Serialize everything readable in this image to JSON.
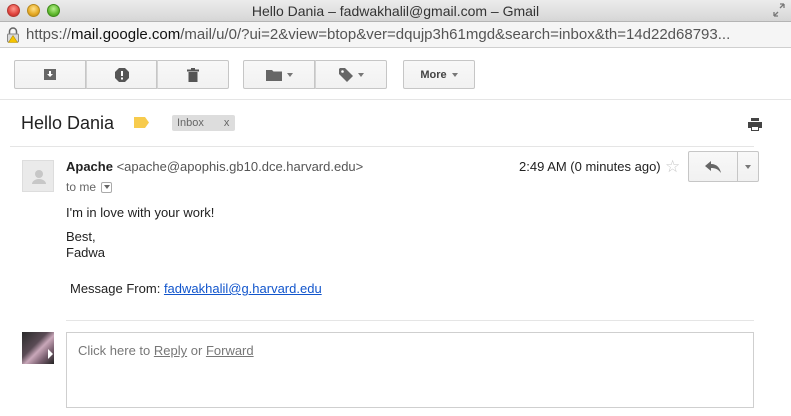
{
  "window": {
    "title": "Hello Dania – fadwakhalil@gmail.com – Gmail"
  },
  "address_bar": {
    "scheme": "https://",
    "host": "mail.google.com",
    "path": "/mail/u/0/?ui=2&view=btop&ver=dqujp3h61mgd&search=inbox&th=14d22d68793..."
  },
  "toolbar": {
    "archive_icon": "archive-icon",
    "spam_icon": "report-spam-icon",
    "delete_icon": "trash-icon",
    "move_icon": "folder-icon",
    "labels_icon": "label-icon",
    "more_label": "More"
  },
  "thread": {
    "subject": "Hello Dania",
    "label_chip": "Inbox",
    "label_chip_remove": "x"
  },
  "message": {
    "sender_name": "Apache",
    "sender_email": "<apache@apophis.gb10.dce.harvard.edu>",
    "to_line": "to me",
    "timestamp": "2:49 AM (0 minutes ago)",
    "body_line1": "I'm in love with your work!",
    "signoff": "Best,",
    "signature": "Fadwa",
    "message_from_label": "Message From:",
    "message_from_link": "fadwakhalil@g.harvard.edu"
  },
  "reply": {
    "prefix": "Click here to",
    "reply_link": "Reply",
    "or": "or",
    "forward_link": "Forward"
  },
  "colors": {
    "link": "#1155cc",
    "label_marker": "#f7cb4d"
  }
}
